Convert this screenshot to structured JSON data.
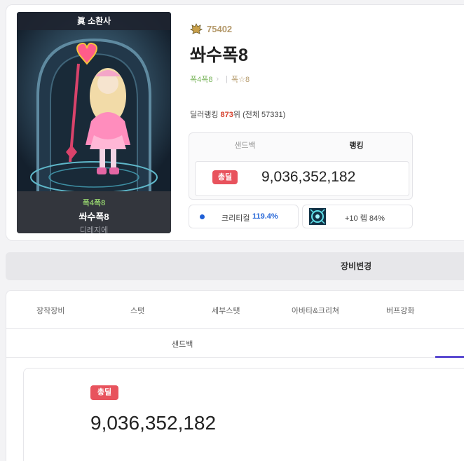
{
  "character": {
    "server_badge": "眞 소환사",
    "adventure": "폭4폭8",
    "name": "쏴수폭8",
    "server": "디레지에"
  },
  "fame": {
    "value": "75402"
  },
  "tags": {
    "adventure": "폭4폭8",
    "guild": "폭☆8"
  },
  "ranking": {
    "prefix": "딜러랭킹 ",
    "rank": "873",
    "suffix": "위 (전체 57331)"
  },
  "damage_box": {
    "tabs": [
      "샌드백",
      "랭킹"
    ],
    "active_tab": "랭킹",
    "badge": "총딜",
    "value": "9,036,352,182"
  },
  "crit_pill": {
    "label": "크리티컬",
    "value": "119.4%"
  },
  "enhance_pill": {
    "text": "+10 렙 84%"
  },
  "equip_change": {
    "label": "장비변경"
  },
  "main_tabs": [
    "장착장비",
    "스탯",
    "세부스탯",
    "아바타&크리쳐",
    "버프강화"
  ],
  "sub_tab": {
    "label": "샌드백"
  },
  "total_damage": {
    "badge": "총딜",
    "value": "9,036,352,182"
  },
  "colors": {
    "accent": "#5c4bd1",
    "badge_red": "#e8535d",
    "crit_blue": "#2b6ad8",
    "rank_red": "#d6402c"
  }
}
